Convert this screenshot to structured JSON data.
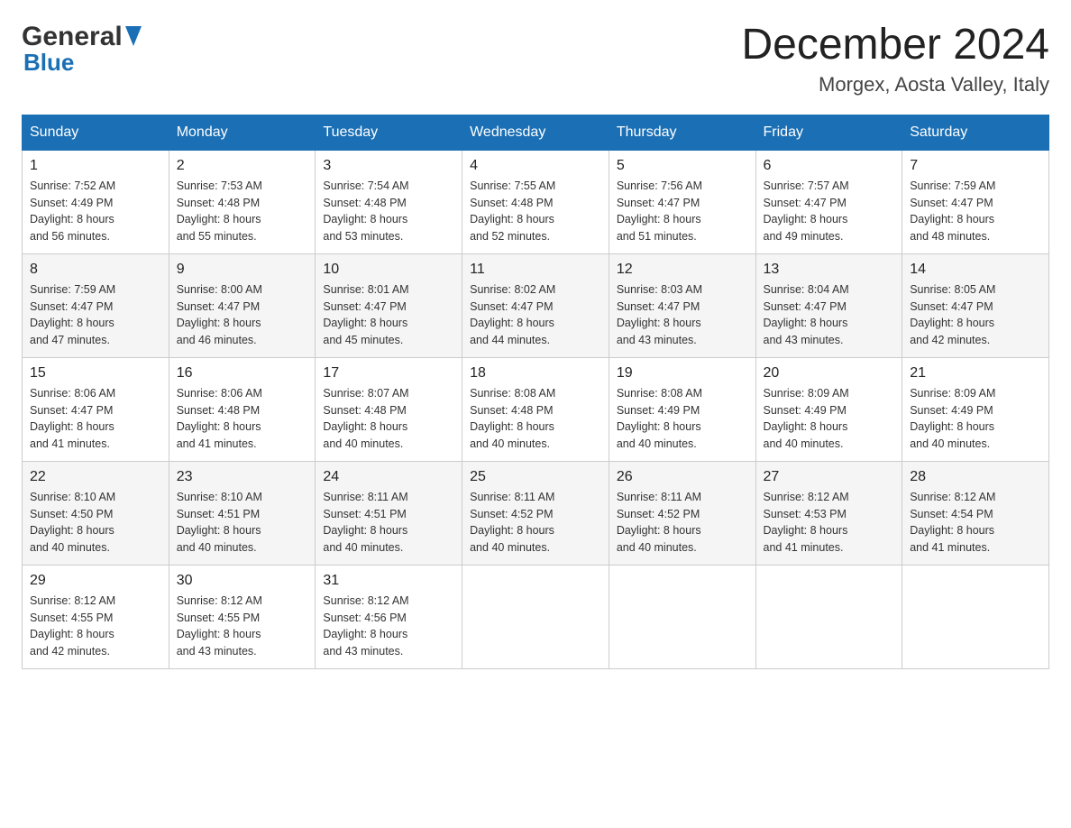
{
  "logo": {
    "general": "General",
    "blue": "Blue"
  },
  "title": {
    "month_year": "December 2024",
    "location": "Morgex, Aosta Valley, Italy"
  },
  "days_of_week": [
    "Sunday",
    "Monday",
    "Tuesday",
    "Wednesday",
    "Thursday",
    "Friday",
    "Saturday"
  ],
  "weeks": [
    [
      {
        "day": "1",
        "sunrise": "7:52 AM",
        "sunset": "4:49 PM",
        "daylight": "8 hours and 56 minutes."
      },
      {
        "day": "2",
        "sunrise": "7:53 AM",
        "sunset": "4:48 PM",
        "daylight": "8 hours and 55 minutes."
      },
      {
        "day": "3",
        "sunrise": "7:54 AM",
        "sunset": "4:48 PM",
        "daylight": "8 hours and 53 minutes."
      },
      {
        "day": "4",
        "sunrise": "7:55 AM",
        "sunset": "4:48 PM",
        "daylight": "8 hours and 52 minutes."
      },
      {
        "day": "5",
        "sunrise": "7:56 AM",
        "sunset": "4:47 PM",
        "daylight": "8 hours and 51 minutes."
      },
      {
        "day": "6",
        "sunrise": "7:57 AM",
        "sunset": "4:47 PM",
        "daylight": "8 hours and 49 minutes."
      },
      {
        "day": "7",
        "sunrise": "7:59 AM",
        "sunset": "4:47 PM",
        "daylight": "8 hours and 48 minutes."
      }
    ],
    [
      {
        "day": "8",
        "sunrise": "7:59 AM",
        "sunset": "4:47 PM",
        "daylight": "8 hours and 47 minutes."
      },
      {
        "day": "9",
        "sunrise": "8:00 AM",
        "sunset": "4:47 PM",
        "daylight": "8 hours and 46 minutes."
      },
      {
        "day": "10",
        "sunrise": "8:01 AM",
        "sunset": "4:47 PM",
        "daylight": "8 hours and 45 minutes."
      },
      {
        "day": "11",
        "sunrise": "8:02 AM",
        "sunset": "4:47 PM",
        "daylight": "8 hours and 44 minutes."
      },
      {
        "day": "12",
        "sunrise": "8:03 AM",
        "sunset": "4:47 PM",
        "daylight": "8 hours and 43 minutes."
      },
      {
        "day": "13",
        "sunrise": "8:04 AM",
        "sunset": "4:47 PM",
        "daylight": "8 hours and 43 minutes."
      },
      {
        "day": "14",
        "sunrise": "8:05 AM",
        "sunset": "4:47 PM",
        "daylight": "8 hours and 42 minutes."
      }
    ],
    [
      {
        "day": "15",
        "sunrise": "8:06 AM",
        "sunset": "4:47 PM",
        "daylight": "8 hours and 41 minutes."
      },
      {
        "day": "16",
        "sunrise": "8:06 AM",
        "sunset": "4:48 PM",
        "daylight": "8 hours and 41 minutes."
      },
      {
        "day": "17",
        "sunrise": "8:07 AM",
        "sunset": "4:48 PM",
        "daylight": "8 hours and 40 minutes."
      },
      {
        "day": "18",
        "sunrise": "8:08 AM",
        "sunset": "4:48 PM",
        "daylight": "8 hours and 40 minutes."
      },
      {
        "day": "19",
        "sunrise": "8:08 AM",
        "sunset": "4:49 PM",
        "daylight": "8 hours and 40 minutes."
      },
      {
        "day": "20",
        "sunrise": "8:09 AM",
        "sunset": "4:49 PM",
        "daylight": "8 hours and 40 minutes."
      },
      {
        "day": "21",
        "sunrise": "8:09 AM",
        "sunset": "4:49 PM",
        "daylight": "8 hours and 40 minutes."
      }
    ],
    [
      {
        "day": "22",
        "sunrise": "8:10 AM",
        "sunset": "4:50 PM",
        "daylight": "8 hours and 40 minutes."
      },
      {
        "day": "23",
        "sunrise": "8:10 AM",
        "sunset": "4:51 PM",
        "daylight": "8 hours and 40 minutes."
      },
      {
        "day": "24",
        "sunrise": "8:11 AM",
        "sunset": "4:51 PM",
        "daylight": "8 hours and 40 minutes."
      },
      {
        "day": "25",
        "sunrise": "8:11 AM",
        "sunset": "4:52 PM",
        "daylight": "8 hours and 40 minutes."
      },
      {
        "day": "26",
        "sunrise": "8:11 AM",
        "sunset": "4:52 PM",
        "daylight": "8 hours and 40 minutes."
      },
      {
        "day": "27",
        "sunrise": "8:12 AM",
        "sunset": "4:53 PM",
        "daylight": "8 hours and 41 minutes."
      },
      {
        "day": "28",
        "sunrise": "8:12 AM",
        "sunset": "4:54 PM",
        "daylight": "8 hours and 41 minutes."
      }
    ],
    [
      {
        "day": "29",
        "sunrise": "8:12 AM",
        "sunset": "4:55 PM",
        "daylight": "8 hours and 42 minutes."
      },
      {
        "day": "30",
        "sunrise": "8:12 AM",
        "sunset": "4:55 PM",
        "daylight": "8 hours and 43 minutes."
      },
      {
        "day": "31",
        "sunrise": "8:12 AM",
        "sunset": "4:56 PM",
        "daylight": "8 hours and 43 minutes."
      },
      null,
      null,
      null,
      null
    ]
  ]
}
